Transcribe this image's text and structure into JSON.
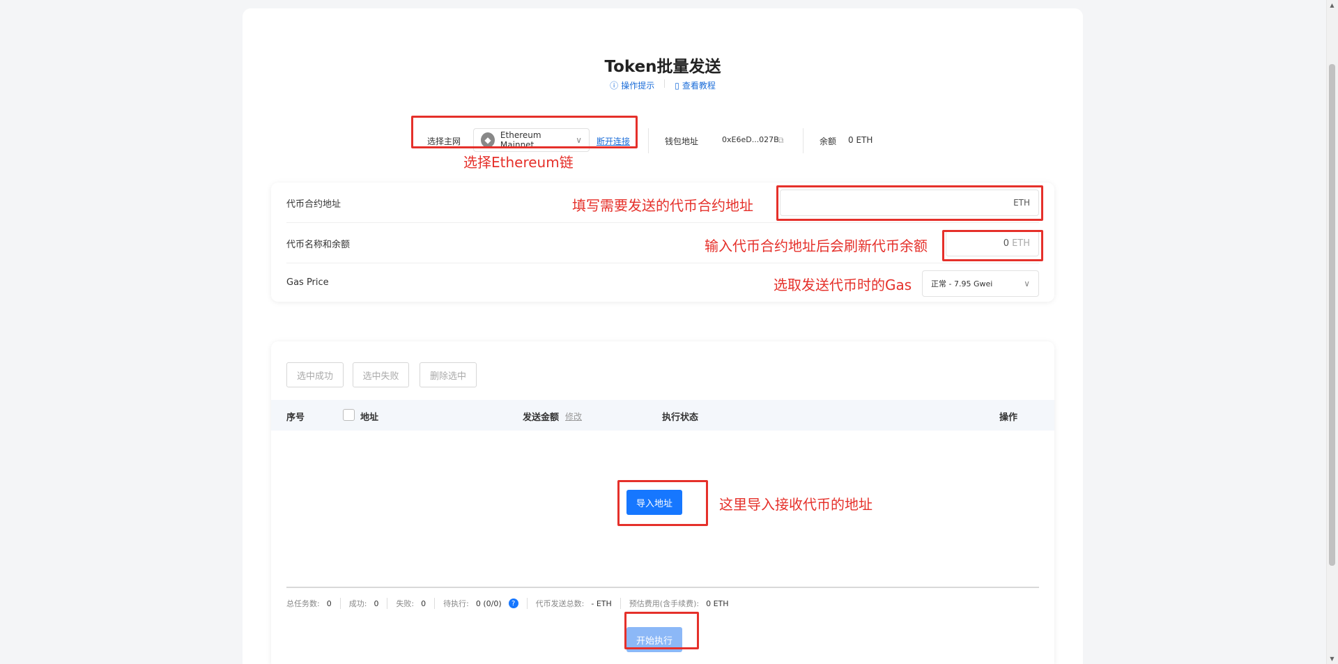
{
  "header": {
    "title": "Token批量发送",
    "tip_label": "操作提示",
    "tutorial_label": "查看教程"
  },
  "network": {
    "label": "选择主网",
    "selected": "Ethereum Mainnet",
    "disconnect": "断开连接",
    "wallet_label": "钱包地址",
    "wallet_address": "0xE6eD...027B",
    "balance_label": "余额",
    "balance_value": "0 ETH"
  },
  "form": {
    "contract_label": "代币合约地址",
    "contract_unit": "ETH",
    "name_balance_label": "代币名称和余额",
    "name_balance_value": "0",
    "name_balance_unit": "ETH",
    "gas_label": "Gas Price",
    "gas_selected": "正常 - 7.95 Gwei"
  },
  "toolbar": {
    "select_success": "选中成功",
    "select_failed": "选中失败",
    "delete_selected": "删除选中"
  },
  "table": {
    "col_index": "序号",
    "col_address": "地址",
    "col_amount": "发送金额",
    "col_amount_edit": "修改",
    "col_status": "执行状态",
    "col_action": "操作",
    "import_button": "导入地址"
  },
  "stats": {
    "total_label": "总任务数:",
    "total_value": "0",
    "success_label": "成功:",
    "success_value": "0",
    "failed_label": "失败:",
    "failed_value": "0",
    "pending_label": "待执行:",
    "pending_value": "0 (0/0)",
    "sent_total_label": "代币发送总数:",
    "sent_total_value": "- ETH",
    "fee_label": "预估费用(含手续费):",
    "fee_value": "0 ETH"
  },
  "start_button": "开始执行",
  "annotations": {
    "chain": "选择Ethereum链",
    "contract": "填写需要发送的代币合约地址",
    "balance": "输入代币合约地址后会刷新代币余额",
    "gas": "选取发送代币时的Gas",
    "import": "这里导入接收代币的地址"
  },
  "colors": {
    "accent": "#1677ff",
    "annotation": "#e5302a",
    "start_disabled": "#8cb8f7"
  }
}
